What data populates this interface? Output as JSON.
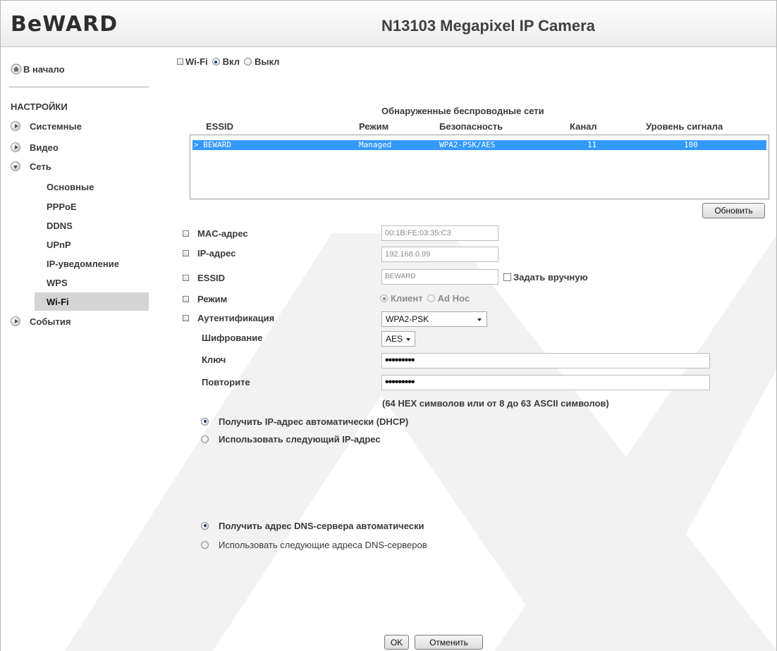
{
  "header": {
    "logo": "BeWARD",
    "title": "N13103 Megapixel IP Camera"
  },
  "sidebar": {
    "home": "В начало",
    "settings_heading": "НАСТРОЙКИ",
    "groups": {
      "system": "Системные",
      "video": "Видео",
      "network": "Сеть",
      "events": "События"
    },
    "network_items": [
      "Основные",
      "PPPoE",
      "DDNS",
      "UPnP",
      "IP-уведомление",
      "WPS",
      "Wi-Fi"
    ]
  },
  "wifi": {
    "label": "Wi-Fi",
    "on_label": "Вкл",
    "off_label": "Выкл"
  },
  "networks": {
    "title": "Обнаруженные беспроводные сети",
    "columns": [
      "ESSID",
      "Режим",
      "Безопасность",
      "Канал",
      "Уровень сигнала"
    ],
    "rows": [
      {
        "essid": "> BEWARD",
        "mode": "Managed",
        "security": "WPA2-PSK/AES",
        "channel": "11",
        "signal": "100"
      }
    ],
    "refresh_label": "Обновить"
  },
  "form": {
    "mac_label": "MAC-адрес",
    "mac_value": "00:1B:FE:03:35:C3",
    "ip_label": "IP-адрес",
    "ip_value": "192.168.0.99",
    "essid_label": "ESSID",
    "essid_value": "BEWARD",
    "manual_label": "Задать вручную",
    "mode_label": "Режим",
    "mode_client": "Клиент",
    "mode_adhoc": "Ad Hoc",
    "auth_label": "Аутентификация",
    "auth_value": "WPA2-PSK",
    "enc_label": "Шифрование",
    "enc_value": "AES",
    "key_label": "Ключ",
    "key_value": "•••••••••",
    "repeat_label": "Повторите",
    "repeat_value": "•••••••••",
    "hint": "(64 HEX символов или от 8 до 63 ASCII символов)",
    "dhcp_label": "Получить IP-адрес автоматически (DHCP)",
    "static_label": "Использовать следующий IP-адрес",
    "dns_auto_label": "Получить адрес DNS-сервера автоматически",
    "dns_manual_label": "Использовать следующие адреса DNS-серверов"
  },
  "buttons": {
    "ok": "OK",
    "cancel": "Отменить"
  },
  "colors": {
    "selection": "#3399ff",
    "active_nav": "#d4d4d4",
    "watermark": "#f2f2f2"
  }
}
